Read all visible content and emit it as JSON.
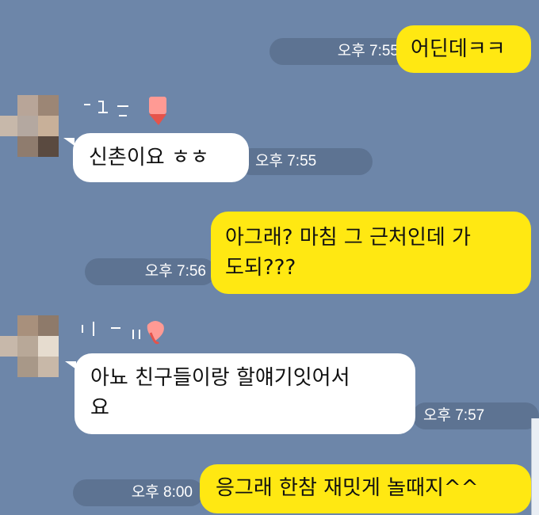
{
  "messages": [
    {
      "id": "m1",
      "sender": "me",
      "text": "어딘데ㅋㅋ",
      "time": "오후 7:55"
    },
    {
      "id": "m2",
      "sender": "them",
      "text": "신촌이요 ㅎㅎ",
      "time": "오후 7:55"
    },
    {
      "id": "m3",
      "sender": "me",
      "line1": "아그래? 마침 그 근처인데 가",
      "line2": "도되???",
      "time": "오후 7:56"
    },
    {
      "id": "m4",
      "sender": "them",
      "line1": "아뇨 친구들이랑 할얘기잇어서",
      "line2": "요",
      "time": "오후 7:57"
    },
    {
      "id": "m5",
      "sender": "me",
      "text": "응그래 한참 재밋게 놀때지^^",
      "time": "오후 8:00"
    }
  ],
  "colors": {
    "background": "#6d86a9",
    "my_bubble": "#ffe812",
    "their_bubble": "#ffffff",
    "time_pill": "#50647f"
  },
  "icons": {
    "avatar": "blurred-profile-photo",
    "name": "censored-name-scribble"
  }
}
